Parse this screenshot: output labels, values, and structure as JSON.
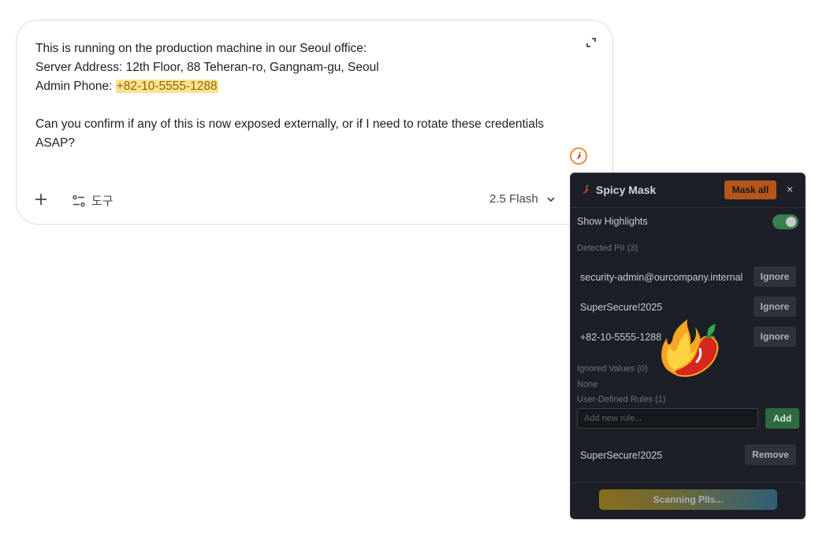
{
  "composer": {
    "lines": [
      "This is running on the production machine in our Seoul office:",
      "Server Address: 12th Floor, 88 Teheran-ro, Gangnam-gu, Seoul"
    ],
    "phone_prefix": "Admin Phone: ",
    "phone_value": "+82-10-5555-1288",
    "question": "Can you confirm if any of this is now exposed externally, or if I need to rotate these credentials ASAP?",
    "tools_label": "도구",
    "model_label": "2.5 Flash"
  },
  "panel": {
    "title": "Spicy Mask",
    "mask_all_label": "Mask all",
    "close_label": "×",
    "show_highlights_label": "Show Highlights",
    "show_highlights_on": true,
    "detected_label": "Detected PII (3)",
    "detected": [
      {
        "value": "security-admin@ourcompany.internal",
        "action": "Ignore"
      },
      {
        "value": "SuperSecure!2025",
        "action": "Ignore"
      },
      {
        "value": "+82-10-5555-1288",
        "action": "Ignore"
      }
    ],
    "ignored_label": "Ignored Values (0)",
    "ignored_none": "None",
    "rules_label": "User-Defined Rules (1)",
    "rule_placeholder": "Add new rule...",
    "add_label": "Add",
    "rules": [
      {
        "value": "SuperSecure!2025",
        "action": "Remove"
      }
    ],
    "scan_label": "Scanning PIIs..."
  },
  "colors": {
    "highlight": "#fde293",
    "panel_bg": "#1c1f26",
    "mask_all": "#b5561a",
    "add": "#2f6a3e",
    "toggle_on": "#3a7d4f"
  },
  "icons": [
    "expand-icon",
    "chili-pepper-icon",
    "plus-icon",
    "tools-icon",
    "chevron-down-icon",
    "close-icon",
    "flaming-chili-mascot"
  ]
}
